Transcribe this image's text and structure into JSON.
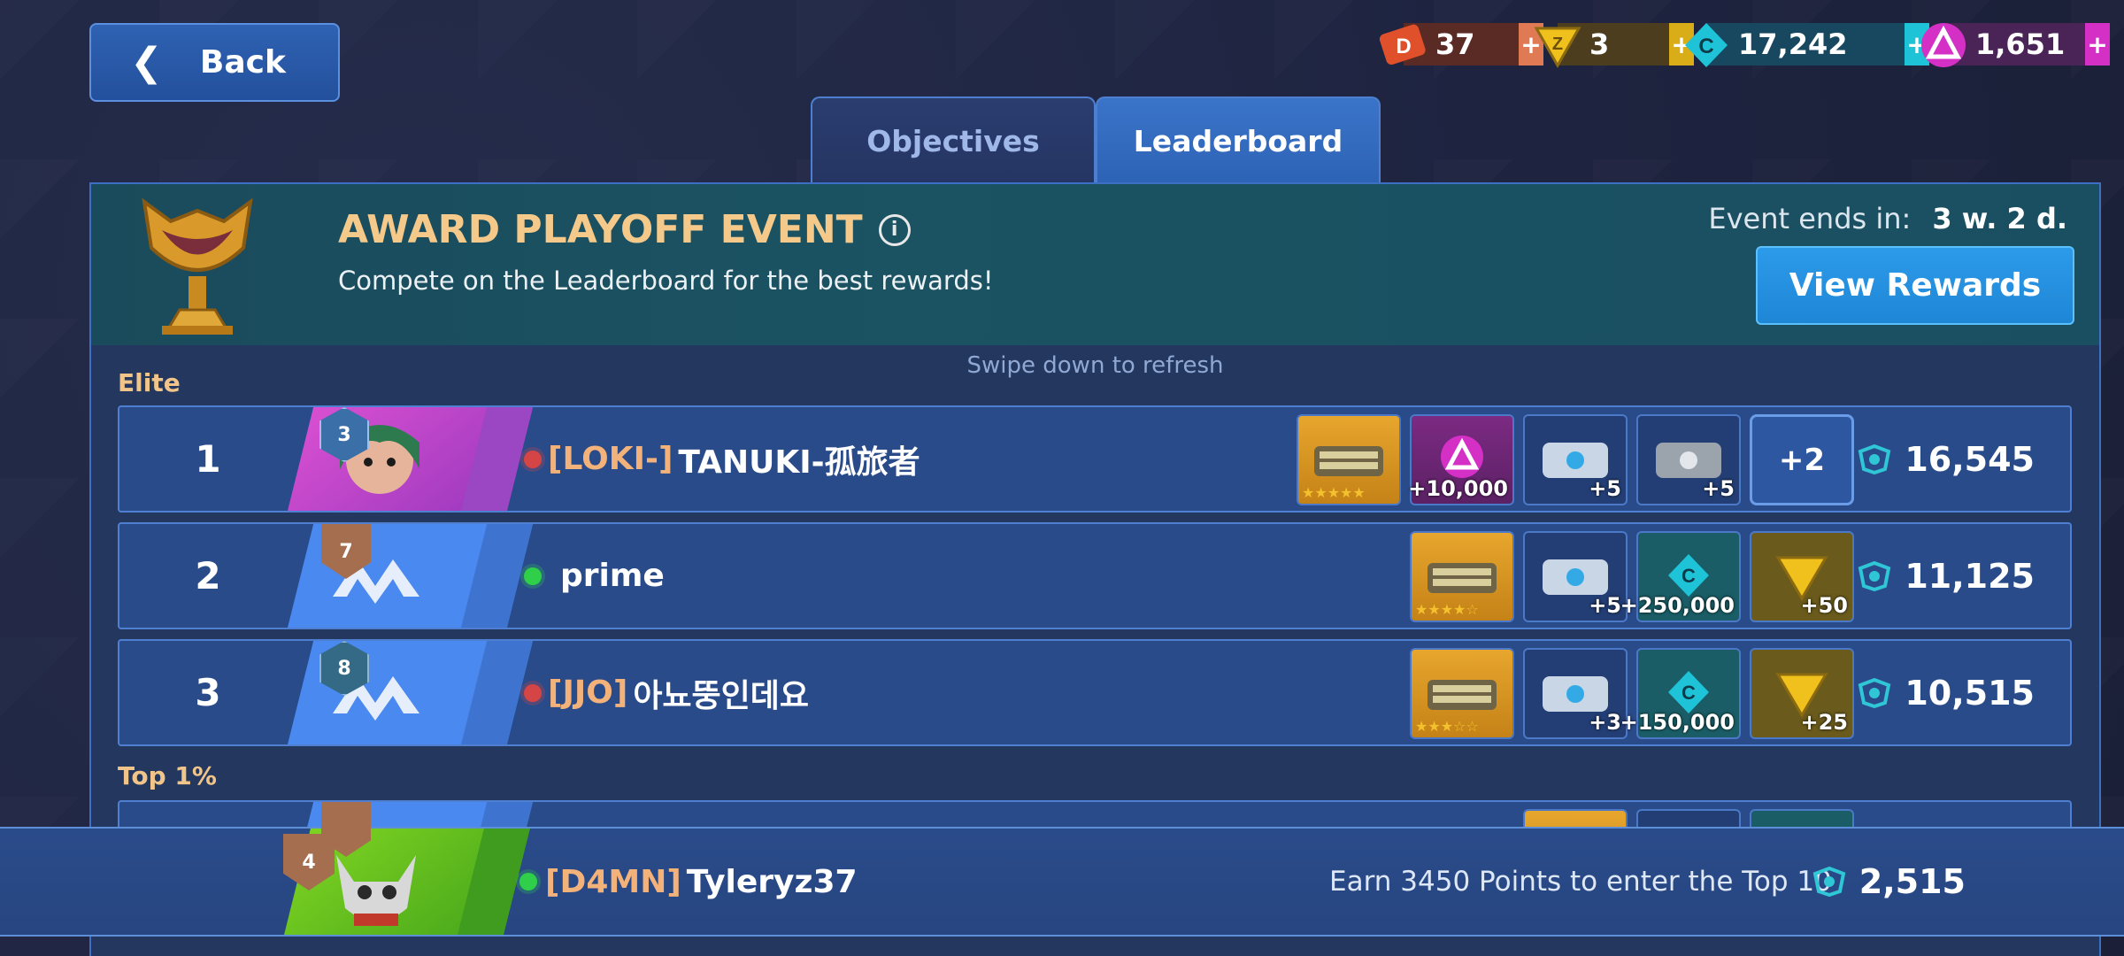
{
  "nav": {
    "back_label": "Back"
  },
  "currencies": [
    {
      "name": "event-tickets",
      "value": "37",
      "color": "#e0502a",
      "box": "#5a2a25",
      "plus_color": "#e07a55"
    },
    {
      "name": "premium-tokens",
      "value": "3",
      "color": "#e2b016",
      "box": "#4c3d1e",
      "plus_color": "#d8ad18"
    },
    {
      "name": "credits",
      "value": "17,242",
      "color": "#19c2d6",
      "box": "#18485f",
      "plus_color": "#1ec3d8"
    },
    {
      "name": "gems",
      "value": "1,651",
      "color": "#d63ac8",
      "box": "#4a2357",
      "plus_color": "#d430c6"
    }
  ],
  "tabs": [
    {
      "label": "Objectives",
      "active": false
    },
    {
      "label": "Leaderboard",
      "active": true
    }
  ],
  "event": {
    "title": "AWARD PLAYOFF EVENT",
    "subtitle": "Compete on the Leaderboard for the best rewards!",
    "ends_label": "Event ends in:",
    "ends_value": "3 w. 2 d.",
    "view_rewards": "View Rewards"
  },
  "swipe_hint": "Swipe down to refresh",
  "sections": {
    "elite": "Elite",
    "top1": "Top 1%"
  },
  "rows": [
    {
      "rank": "1",
      "level": "3",
      "clan": "[LOKI-]",
      "name": "TANUKI-孤旅者",
      "online": false,
      "score": "16,545",
      "more": "+2",
      "rewards": [
        {
          "type": "gold-chest",
          "stars": "★★★★★",
          "amt": ""
        },
        {
          "type": "gems",
          "amt": "+10,000"
        },
        {
          "type": "blue-crate",
          "amt": "+5"
        },
        {
          "type": "silver-crate",
          "amt": "+5"
        }
      ]
    },
    {
      "rank": "2",
      "level": "7",
      "clan": "",
      "name": "prime",
      "online": true,
      "score": "11,125",
      "rewards": [
        {
          "type": "gold-chest",
          "stars": "★★★★☆",
          "amt": ""
        },
        {
          "type": "blue-crate",
          "amt": "+5"
        },
        {
          "type": "credits",
          "amt": "+250,000"
        },
        {
          "type": "tokens",
          "amt": "+50"
        }
      ]
    },
    {
      "rank": "3",
      "level": "8",
      "clan": "[JJO]",
      "name": "아뇨뚱인데요",
      "online": false,
      "score": "10,515",
      "rewards": [
        {
          "type": "gold-chest",
          "stars": "★★★☆☆",
          "amt": ""
        },
        {
          "type": "blue-crate",
          "amt": "+3"
        },
        {
          "type": "credits",
          "amt": "+150,000"
        },
        {
          "type": "tokens",
          "amt": "+25"
        }
      ]
    }
  ],
  "me": {
    "level": "4",
    "clan": "[D4MN]",
    "name": "Tyleryz37",
    "online": true,
    "earn_text": "Earn 3450 Points to enter the Top 10",
    "score": "2,515"
  }
}
